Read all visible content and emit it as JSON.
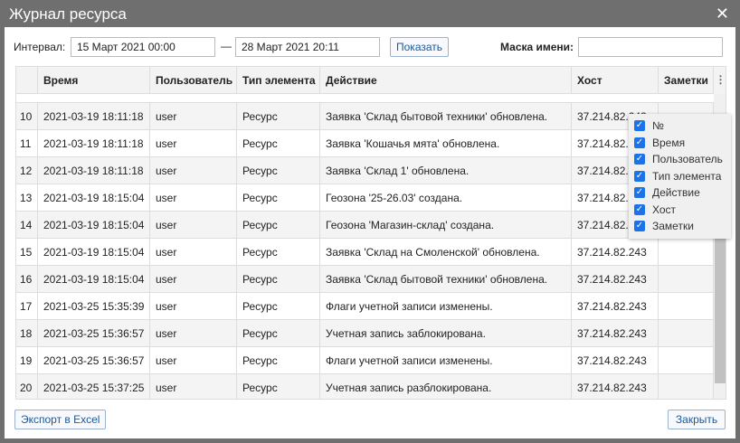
{
  "title": "Журнал ресурса",
  "filter": {
    "interval_label": "Интервал:",
    "from": "15 Март 2021 00:00",
    "dash": "—",
    "to": "28 Март 2021 20:11",
    "show": "Показать",
    "mask_label": "Маска имени:",
    "mask_value": ""
  },
  "columns": [
    "",
    "Время",
    "Пользователь",
    "Тип элемента",
    "Действие",
    "Хост",
    "Заметки"
  ],
  "rows": [
    [
      "10",
      "2021-03-19 18:11:18",
      "user",
      "Ресурс",
      "Заявка 'Склад бытовой техники' обновлена.",
      "37.214.82.243",
      ""
    ],
    [
      "11",
      "2021-03-19 18:11:18",
      "user",
      "Ресурс",
      "Заявка 'Кошачья мята' обновлена.",
      "37.214.82.243",
      ""
    ],
    [
      "12",
      "2021-03-19 18:11:18",
      "user",
      "Ресурс",
      "Заявка 'Склад 1' обновлена.",
      "37.214.82.243",
      ""
    ],
    [
      "13",
      "2021-03-19 18:15:04",
      "user",
      "Ресурс",
      "Геозона '25-26.03' создана.",
      "37.214.82.243",
      ""
    ],
    [
      "14",
      "2021-03-19 18:15:04",
      "user",
      "Ресурс",
      "Геозона 'Магазин-склад' создана.",
      "37.214.82.243",
      ""
    ],
    [
      "15",
      "2021-03-19 18:15:04",
      "user",
      "Ресурс",
      "Заявка 'Склад на Смоленской' обновлена.",
      "37.214.82.243",
      ""
    ],
    [
      "16",
      "2021-03-19 18:15:04",
      "user",
      "Ресурс",
      "Заявка 'Склад бытовой техники' обновлена.",
      "37.214.82.243",
      ""
    ],
    [
      "17",
      "2021-03-25 15:35:39",
      "user",
      "Ресурс",
      "Флаги учетной записи изменены.",
      "37.214.82.243",
      ""
    ],
    [
      "18",
      "2021-03-25 15:36:57",
      "user",
      "Ресурс",
      "Учетная запись заблокирована.",
      "37.214.82.243",
      ""
    ],
    [
      "19",
      "2021-03-25 15:36:57",
      "user",
      "Ресурс",
      "Флаги учетной записи изменены.",
      "37.214.82.243",
      ""
    ],
    [
      "20",
      "2021-03-25 15:37:25",
      "user",
      "Ресурс",
      "Учетная запись разблокирована.",
      "37.214.82.243",
      ""
    ]
  ],
  "column_menu": [
    {
      "label": "№",
      "checked": true
    },
    {
      "label": "Время",
      "checked": true
    },
    {
      "label": "Пользователь",
      "checked": true
    },
    {
      "label": "Тип элемента",
      "checked": true
    },
    {
      "label": "Действие",
      "checked": true
    },
    {
      "label": "Хост",
      "checked": true
    },
    {
      "label": "Заметки",
      "checked": true
    }
  ],
  "footer": {
    "export": "Экспорт в Excel",
    "close": "Закрыть"
  }
}
